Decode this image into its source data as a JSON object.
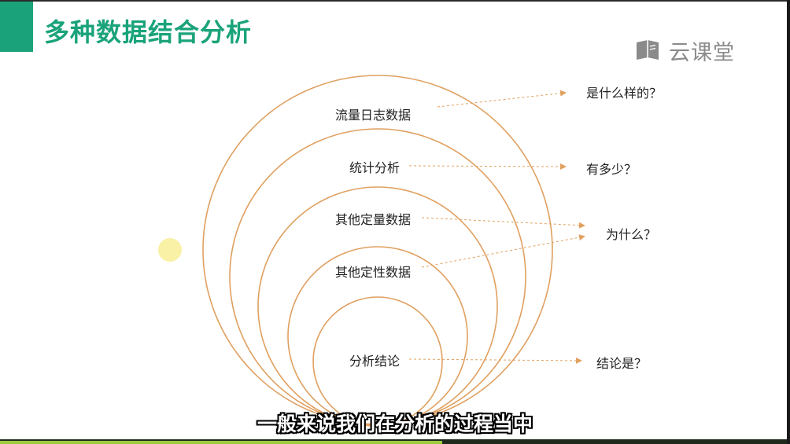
{
  "slide": {
    "title": "多种数据结合分析",
    "logo_text": "云课堂",
    "logo_icon": "book-icon",
    "accent_color": "#1aa37a",
    "ring_color": "#e0a060"
  },
  "rings": [
    {
      "label": "流量日志数据",
      "question": "是什么样的？"
    },
    {
      "label": "统计分析",
      "question": "有多少？"
    },
    {
      "label": "其他定量数据",
      "question": "为什么？"
    },
    {
      "label": "其他定性数据",
      "question": ""
    },
    {
      "label": "分析结论",
      "question": "结论是？"
    }
  ],
  "subtitle": "一般来说我们在分析的过程当中",
  "video_progress": 0.56
}
